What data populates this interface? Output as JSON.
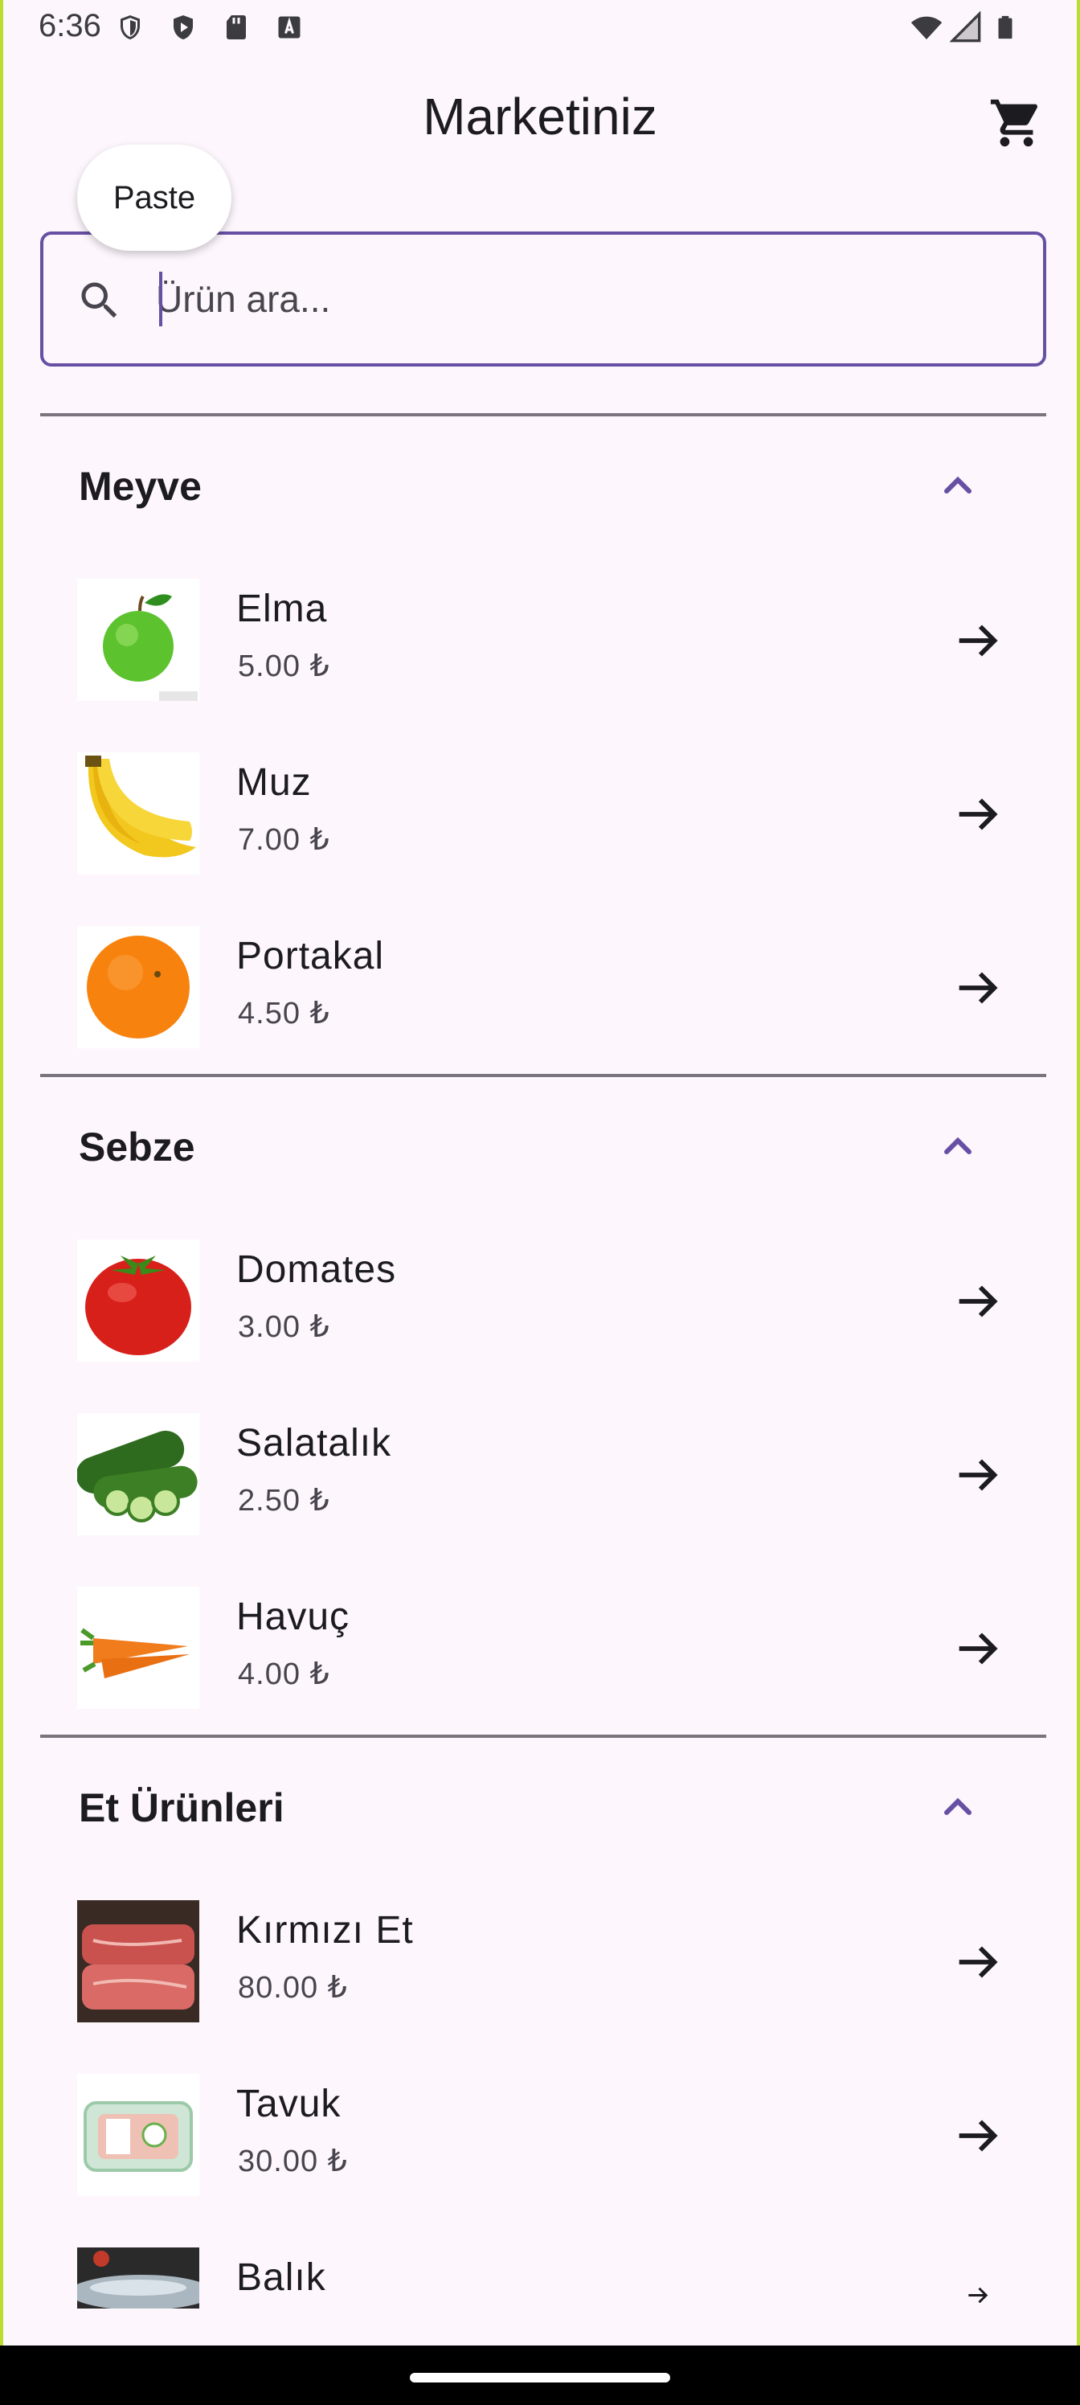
{
  "status_bar": {
    "time": "6:36",
    "icons": [
      "shield-icon",
      "play-protect-icon",
      "sd-card-icon",
      "keyboard-a-icon",
      "wifi-icon",
      "signal-icon",
      "battery-icon"
    ]
  },
  "app_bar": {
    "title": "Marketiniz",
    "cart_icon": "shopping-cart-icon"
  },
  "paste_tooltip": {
    "label": "Paste"
  },
  "search": {
    "placeholder": "Ürün ara...",
    "value": "",
    "icon": "search-icon"
  },
  "colors": {
    "accent": "#6750a4",
    "background": "#fdf7fd",
    "divider": "#79747e",
    "text_primary": "#1c1b1f",
    "text_secondary": "#49454f"
  },
  "categories": [
    {
      "title": "Meyve",
      "expanded": true,
      "items": [
        {
          "name": "Elma",
          "price": "5.00 ₺",
          "image": "green-apple"
        },
        {
          "name": "Muz",
          "price": "7.00 ₺",
          "image": "banana"
        },
        {
          "name": "Portakal",
          "price": "4.50 ₺",
          "image": "orange"
        }
      ]
    },
    {
      "title": "Sebze",
      "expanded": true,
      "items": [
        {
          "name": "Domates",
          "price": "3.00 ₺",
          "image": "tomato"
        },
        {
          "name": "Salatalık",
          "price": "2.50 ₺",
          "image": "cucumber"
        },
        {
          "name": "Havuç",
          "price": "4.00 ₺",
          "image": "carrot"
        }
      ]
    },
    {
      "title": "Et Ürünleri",
      "expanded": true,
      "items": [
        {
          "name": "Kırmızı Et",
          "price": "80.00 ₺",
          "image": "red-meat"
        },
        {
          "name": "Tavuk",
          "price": "30.00 ₺",
          "image": "chicken-package"
        },
        {
          "name": "Balık",
          "price": "",
          "image": "fish"
        }
      ]
    }
  ]
}
